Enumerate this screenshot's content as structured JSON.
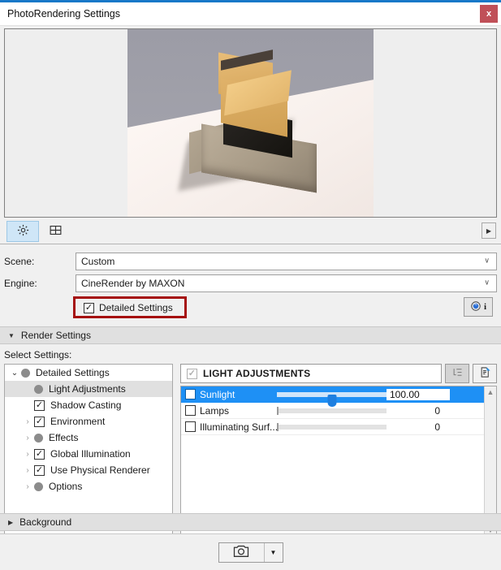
{
  "window": {
    "title": "PhotoRendering Settings",
    "close_label": "x",
    "accent_color": "#1878c8",
    "close_color": "#c05058"
  },
  "preview": {
    "name": "render-preview",
    "description": "3D rendered building on white ground plane"
  },
  "tabs": [
    {
      "id": "settings",
      "icon": "gear-icon",
      "active": true
    },
    {
      "id": "layout",
      "icon": "grid-layout-icon",
      "active": false
    }
  ],
  "scroll_right_icon": "▶",
  "form": {
    "scene": {
      "label": "Scene:",
      "value": "Custom",
      "caret": "∨"
    },
    "engine": {
      "label": "Engine:",
      "value": "CineRender by MAXON",
      "caret": "∨"
    },
    "detailed_settings": {
      "label": "Detailed Settings",
      "checked": true,
      "check_glyph": "✓",
      "highlight_color": "#a50e0e"
    },
    "info_button": {
      "icon": "sphere-icon",
      "letter": "i"
    }
  },
  "render_settings": {
    "header": "Render Settings",
    "expanded": true,
    "triangle": "▼",
    "select_settings_label": "Select Settings:",
    "tree": [
      {
        "label": "Detailed Settings",
        "chevron": "⌄",
        "marker": "dot",
        "indent": 0,
        "selected": false
      },
      {
        "label": "Light Adjustments",
        "chevron": "",
        "marker": "dot",
        "indent": 1,
        "selected": true
      },
      {
        "label": "Shadow Casting",
        "chevron": "",
        "marker": "check",
        "indent": 1,
        "selected": false
      },
      {
        "label": "Environment",
        "chevron": "›",
        "marker": "check",
        "indent": 1,
        "selected": false
      },
      {
        "label": "Effects",
        "chevron": "›",
        "marker": "dot",
        "indent": 1,
        "selected": false
      },
      {
        "label": "Global Illumination",
        "chevron": "›",
        "marker": "check",
        "indent": 1,
        "selected": false
      },
      {
        "label": "Use Physical Renderer",
        "chevron": "›",
        "marker": "check",
        "indent": 1,
        "selected": false
      },
      {
        "label": "Options",
        "chevron": "›",
        "marker": "dot",
        "indent": 1,
        "selected": false
      }
    ],
    "panel": {
      "title": "LIGHT ADJUSTMENTS",
      "title_checked": true,
      "check_glyph": "✓",
      "buttons": [
        {
          "name": "tree-list-button",
          "icon": "tree-list-icon",
          "enabled": false
        },
        {
          "name": "export-document-button",
          "icon": "document-arrow-icon",
          "enabled": true
        }
      ],
      "rows": [
        {
          "label": "Sunlight",
          "checked": true,
          "value": "100.00",
          "percent": 50,
          "selected": true
        },
        {
          "label": "Lamps",
          "checked": false,
          "value": "0",
          "percent": 0,
          "selected": false
        },
        {
          "label": "Illuminating Surf...",
          "checked": false,
          "value": "0",
          "percent": 0,
          "selected": false
        }
      ],
      "scroll_up": "▲",
      "scroll_down": "▼"
    }
  },
  "background_section": {
    "header": "Background",
    "expanded": false,
    "triangle": "▶"
  },
  "footer": {
    "camera_button": {
      "name": "render-camera-button",
      "icon": "camera-icon"
    },
    "dropdown": {
      "name": "camera-dropdown-button",
      "icon": "caret-down-icon",
      "glyph": "▼"
    }
  }
}
